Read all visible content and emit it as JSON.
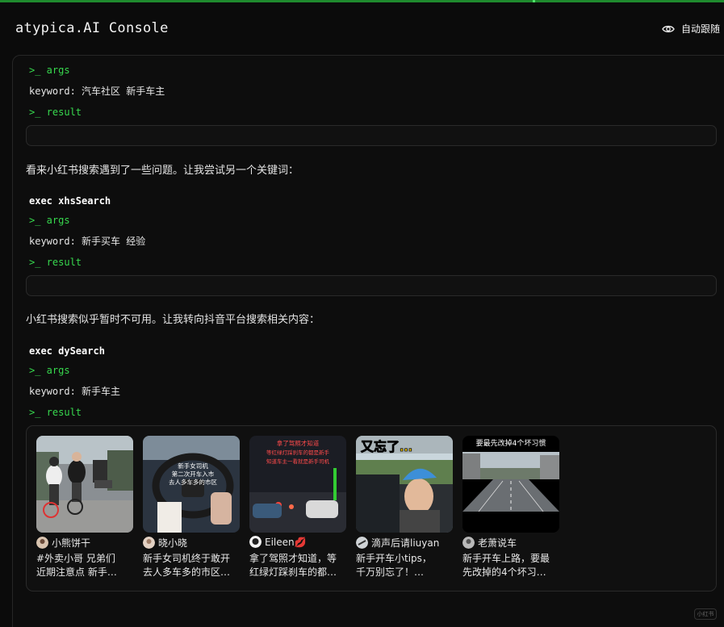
{
  "app": {
    "title": "atypica.AI Console",
    "follow_label": "自动跟随"
  },
  "log": {
    "block1": {
      "args_label": ">_ args",
      "keyword": "keyword: 汽车社区 新手车主",
      "result_label": ">_ result"
    },
    "msg1": "看来小红书搜索遇到了一些问题。让我尝试另一个关键词：",
    "block2": {
      "exec": "exec xhsSearch",
      "args_label": ">_ args",
      "keyword": "keyword: 新手买车 经验",
      "result_label": ">_ result"
    },
    "msg2": "小红书搜索似乎暂时不可用。让我转向抖音平台搜索相关内容：",
    "block3": {
      "exec": "exec dySearch",
      "args_label": ">_ args",
      "keyword": "keyword: 新手车主",
      "result_label": ">_ result"
    }
  },
  "results": [
    {
      "author": "小熊饼干",
      "desc1": "#外卖小哥  兄弟们",
      "desc2": "近期注意点   新手…",
      "overlay": []
    },
    {
      "author": "晓小晓",
      "desc1": "新手女司机终于敢开",
      "desc2": "去人多车多的市区…",
      "overlay": [
        "新手女司机",
        "第二次开车入市",
        "去人多车多的市区"
      ]
    },
    {
      "author": "Eileen💋",
      "desc1": "拿了驾照才知道，等",
      "desc2": "红绿灯踩刹车的都…",
      "overlay": [
        "拿了驾照才知道",
        "等红绿灯踩刹车的都是新手",
        "知道车主一看就是新手司机"
      ]
    },
    {
      "author": "滴声后请liuyan",
      "desc1": "新手开车小tips，",
      "desc2": "千万别忘了！…",
      "overlay": [
        "又忘了…"
      ]
    },
    {
      "author": "老萧说车",
      "desc1": "新手开车上路，要最",
      "desc2": "先改掉的4个坏习…",
      "overlay": [
        "要最先改掉4个坏习惯"
      ]
    }
  ],
  "watermark": "小红书",
  "colors": {
    "accent_green": "#37d94e",
    "top_bar": "#1f8a2e",
    "background": "#0b0b0b"
  }
}
